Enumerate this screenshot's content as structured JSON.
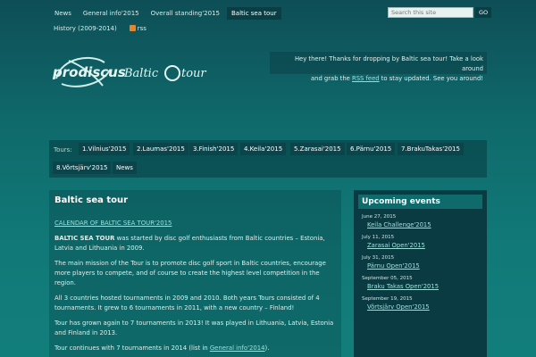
{
  "nav": {
    "top": [
      "News",
      "General info'2015",
      "Overall standing'2015",
      "Baltic sea tour"
    ],
    "row2_history": "History (2009-2014)",
    "row2_rss": "rss"
  },
  "search": {
    "placeholder": "Search this site",
    "button": "GO"
  },
  "logo": {
    "brand": "prodiscus",
    "text1": "Baltic",
    "text2": "tour"
  },
  "welcome": {
    "line1": "Hey there! Thanks for dropping by Baltic sea tour! Take a look around",
    "line2_pre": "and grab the",
    "rss_link": "RSS feed",
    "line2_post": "to stay updated. See you around!"
  },
  "tours": {
    "label": "Tours:",
    "items": [
      "1.Vilnius'2015",
      "2.Laumas'2015",
      "3.Finish'2015",
      "4.Keila'2015",
      "5.Zarasai'2015",
      "6.Pärnu'2015",
      "7.BrakuTakas'2015",
      "8.Võrtsjärv'2015",
      "News"
    ]
  },
  "main": {
    "title": "Baltic sea tour",
    "calendar_link": "CALENDAR OF BALTIC SEA TOUR'2015",
    "p1_strong": "BALTIC SEA TOUR",
    "p1_rest": " was started by disc golf enthusiasts from Baltic countries – Estonia, Latvia and Lithuania in 2009.",
    "p2": "The main mission of the Tour is to promote disc golf sport in Baltic countries, encourage more players to compete, and of course to create the highest level competition in the region.",
    "p3": "All 3 countries hosted tournaments in 2009 and 2010. Both years Tours consisted of 4 tournaments. It grew to 6 tournaments in 2011, with a new country – Finland!",
    "p4": "Tour has grown again to 7 tournaments in 2013! It was played in Lithuania, Latvia, Estonia and Finland in 2013.",
    "p5_pre": "Tour continues with 7 tournaments in 2014 (list in ",
    "p5_link": "General info'2014",
    "p5_post": ")."
  },
  "sidebar": {
    "title": "Upcoming events",
    "events": [
      {
        "date": "June 27, 2015",
        "name": "Keila Challenge'2015"
      },
      {
        "date": "July 11, 2015",
        "name": "Zarasai Open'2015"
      },
      {
        "date": "July 31, 2015",
        "name": "Pärnu Open'2015"
      },
      {
        "date": "September 05, 2015",
        "name": "Braku Takas Open'2015"
      },
      {
        "date": "September 19, 2015",
        "name": "Võrtsjärv Open'2015"
      }
    ]
  }
}
